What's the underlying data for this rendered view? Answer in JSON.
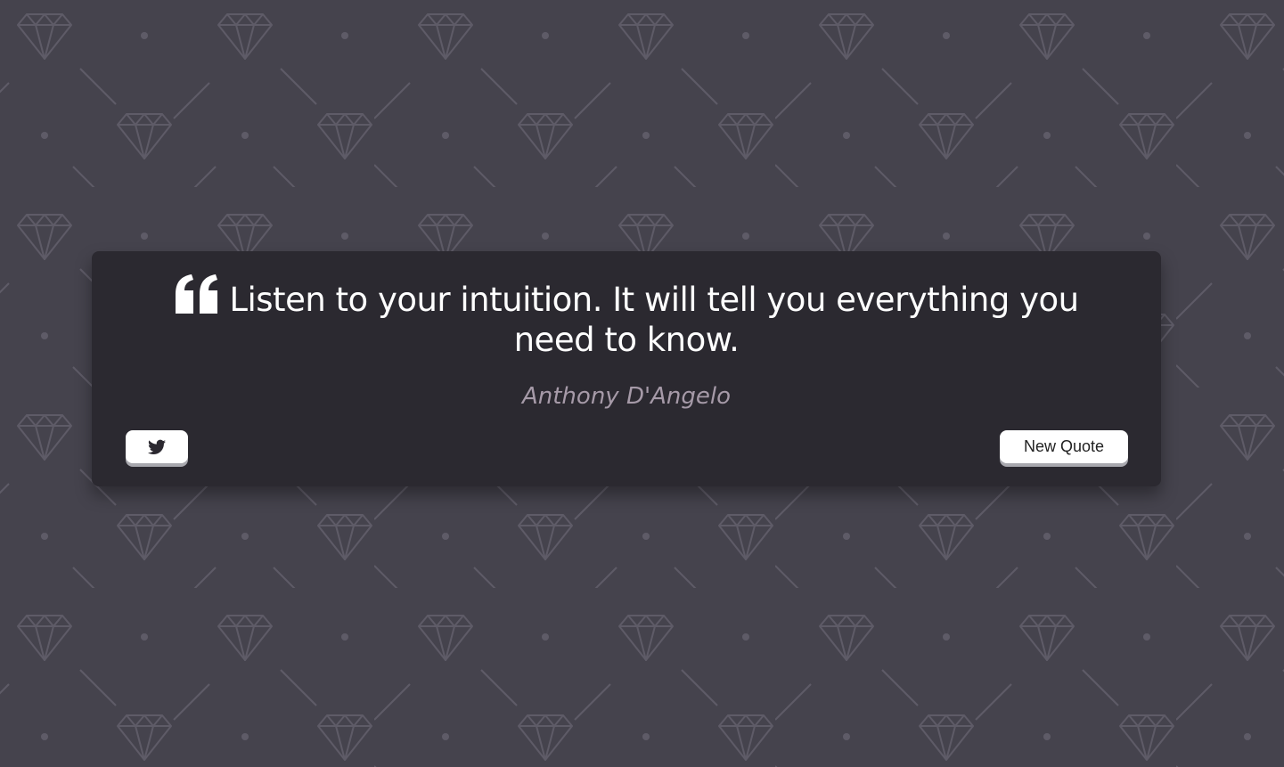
{
  "quote": {
    "text": "Listen to your intuition. It will tell you everything you need to know.",
    "author": "Anthony D'Angelo",
    "quote_icon": "quote-left-icon"
  },
  "buttons": {
    "tweet_icon": "twitter-icon",
    "new_quote_label": "New Quote"
  },
  "colors": {
    "background": "#45434d",
    "card": "#2b2930",
    "quote_text": "#ffffff",
    "author_text": "#a69aa8",
    "button_bg": "#ffffff",
    "button_shadow": "#a8a8ae"
  }
}
